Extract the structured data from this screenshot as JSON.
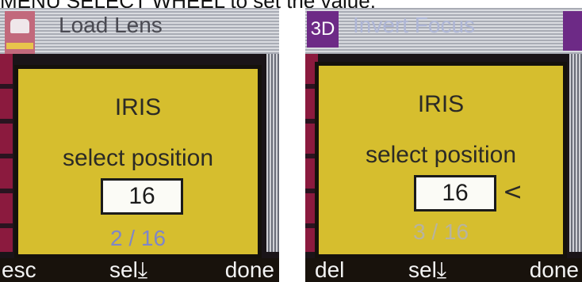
{
  "caption": "MENU SELECT WHEEL to set the value.",
  "left_screen": {
    "title": "Load Lens",
    "icon": "lens-icon",
    "dialog": {
      "title": "IRIS",
      "subtitle": "select position",
      "value": "16",
      "counter": "2 / 16"
    },
    "softkeys": [
      "esc",
      "sel⤓",
      "done"
    ]
  },
  "right_screen": {
    "badge": "3D",
    "title": "Invert Focus",
    "dialog": {
      "title": "IRIS",
      "subtitle": "select position",
      "value": "16",
      "cursor": "<",
      "counter": "3 / 16"
    },
    "softkeys": [
      "del",
      "sel⤓",
      "done"
    ]
  },
  "colors": {
    "dialog_bg": "#d6be2e",
    "counter_left": "#7f86c8",
    "counter_right": "#b7b3a0",
    "title_bar": "#c8cad0",
    "badge": "#6d2a86"
  }
}
